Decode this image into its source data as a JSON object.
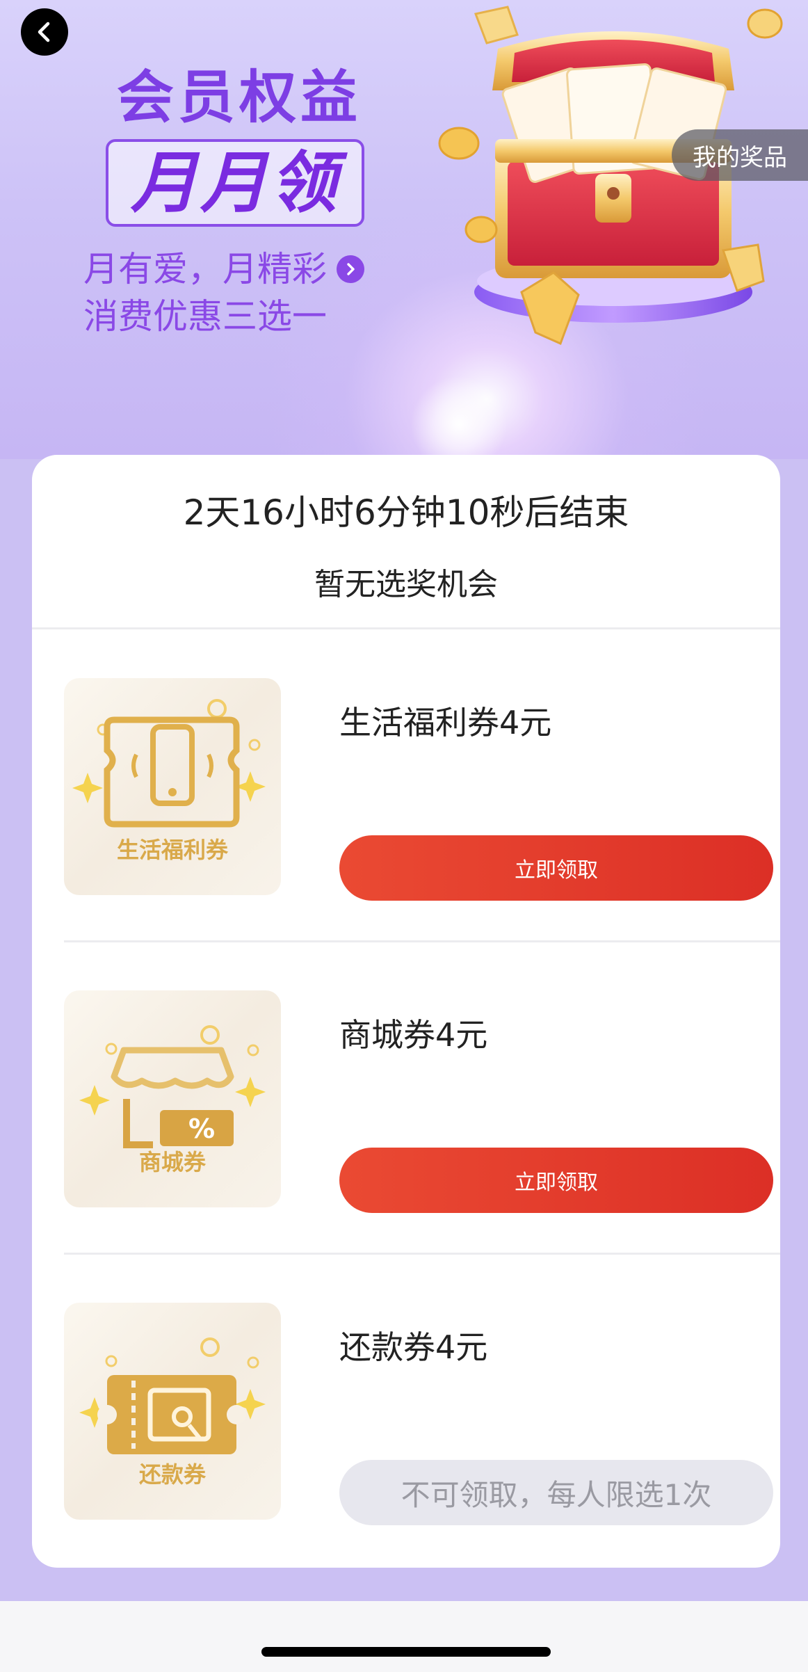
{
  "hero": {
    "title_line1": "会员权益",
    "title_badge": "月月领",
    "subtitle_line1": "月有爱，月精彩",
    "subtitle_line2": "消费优惠三选一",
    "my_prizes_label": "我的奖品",
    "back_icon": "back-arrow-icon",
    "chevron_icon": "chevron-right-icon"
  },
  "status": {
    "countdown": "2天16小时6分钟10秒后结束",
    "chance_text": "暂无选奖机会"
  },
  "items": [
    {
      "title": "生活福利券4元",
      "thumb_label": "生活福利券",
      "icon": "phone-coupon-icon",
      "button": "立即领取",
      "enabled": true
    },
    {
      "title": "商城券4元",
      "thumb_label": "商城券",
      "icon": "shop-coupon-icon",
      "button": "立即领取",
      "enabled": true
    },
    {
      "title": "还款券4元",
      "thumb_label": "还款券",
      "icon": "repay-coupon-icon",
      "button": "不可领取，每人限选1次",
      "enabled": false
    }
  ],
  "colors": {
    "accent_purple": "#7d3ee4",
    "button_red": "#e0362a",
    "gold": "#d9a94a",
    "disabled_bg": "#e7e7ee"
  }
}
